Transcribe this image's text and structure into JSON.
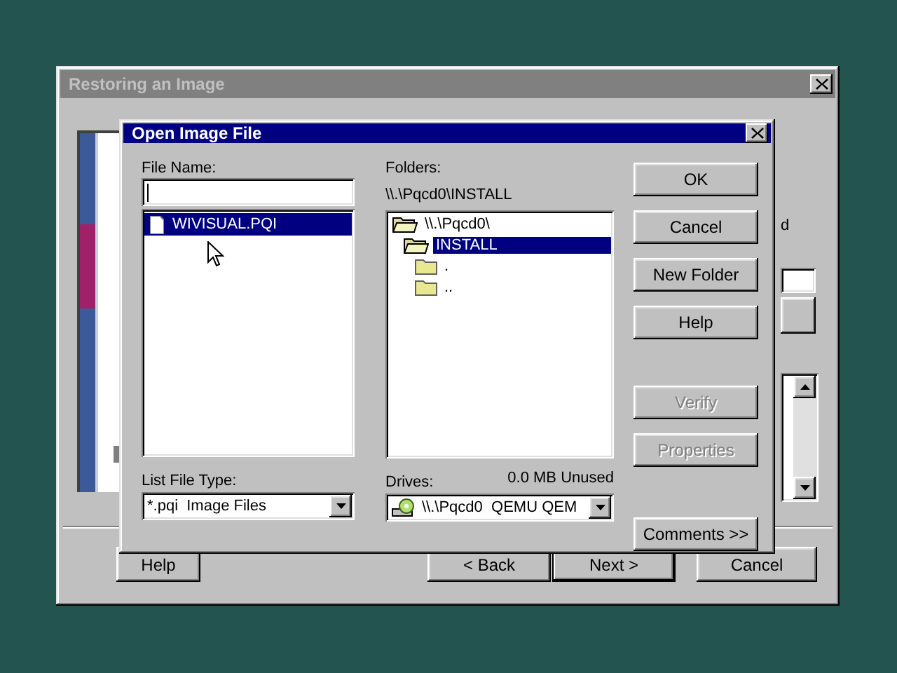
{
  "background_window": {
    "title": "Restoring an Image",
    "partial_label": "d",
    "buttons": [
      {
        "label": "Help",
        "default": false
      },
      {
        "label": "< Back",
        "default": false
      },
      {
        "label": "Next >",
        "default": true
      },
      {
        "label": "Cancel",
        "default": false
      }
    ]
  },
  "dialog": {
    "title": "Open Image File",
    "file_name": {
      "label": "File Name:"
    },
    "files": [
      {
        "name": "WIVISUAL.PQI",
        "selected": true
      }
    ],
    "file_type": {
      "label": "List File Type:",
      "value": "*.pqi  Image Files"
    },
    "folders": {
      "label": "Folders:",
      "path": "\\\\.\\Pqcd0\\INSTALL",
      "tree": [
        {
          "name": "\\\\.\\Pqcd0\\",
          "kind": "open",
          "selected": false,
          "children": [
            {
              "name": "INSTALL",
              "kind": "open",
              "selected": true,
              "children": [
                {
                  "name": ".",
                  "kind": "closed",
                  "selected": false
                },
                {
                  "name": "..",
                  "kind": "closed",
                  "selected": false
                }
              ]
            }
          ]
        }
      ]
    },
    "drives": {
      "label": "Drives:",
      "free": "0.0 MB Unused",
      "value": "\\\\.\\Pqcd0  QEMU QEM"
    },
    "buttons": [
      {
        "label": "OK",
        "disabled": false
      },
      {
        "label": "Cancel",
        "disabled": false
      },
      {
        "label": "New Folder",
        "disabled": false
      },
      {
        "label": "Help",
        "disabled": false
      }
    ],
    "item_buttons": [
      {
        "label": "Verify",
        "disabled": true
      },
      {
        "label": "Properties",
        "disabled": true
      }
    ],
    "comments_button": {
      "label": "Comments >>",
      "disabled": false
    }
  }
}
